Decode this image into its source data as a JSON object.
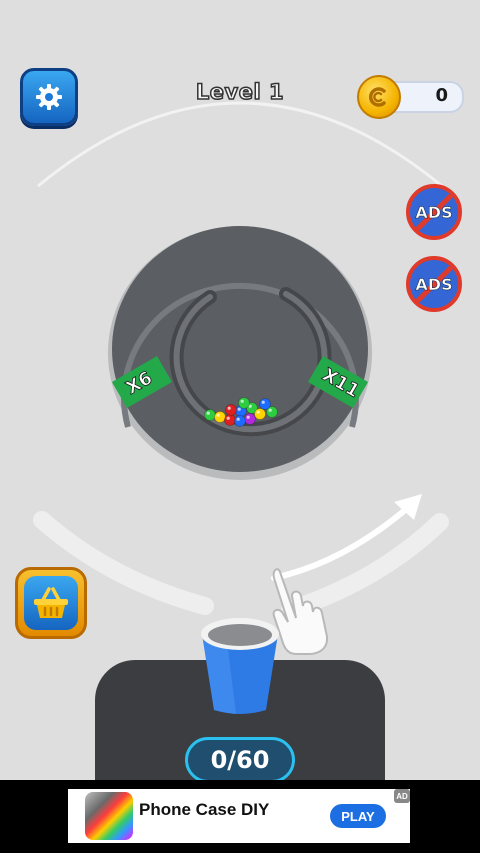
{
  "header": {
    "level_title": "Level 1",
    "coins": "0"
  },
  "icons": {
    "settings": "gear-icon",
    "coin": "coin-icon",
    "shop": "basket-icon",
    "hand": "pointer-hand-icon"
  },
  "side_buttons": {
    "no_ads_1": "ADS",
    "no_ads_2": "ADS"
  },
  "maze": {
    "multiplier_left": "X6",
    "multiplier_right": "X11",
    "balls": [
      {
        "color": "#2ecc40"
      },
      {
        "color": "#ffd400"
      },
      {
        "color": "#e02020"
      },
      {
        "color": "#1e6bff"
      },
      {
        "color": "#b02adf"
      },
      {
        "color": "#2ecc40"
      },
      {
        "color": "#1e6bff"
      },
      {
        "color": "#ffd400"
      },
      {
        "color": "#2ecc40"
      },
      {
        "color": "#1e6bff"
      },
      {
        "color": "#e02020"
      },
      {
        "color": "#2ecc40"
      }
    ]
  },
  "cup": {
    "progress_text": "0/60",
    "filled": 0,
    "capacity": 60
  },
  "ad": {
    "title": "Phone Case DIY",
    "cta": "PLAY",
    "badge": "AD"
  },
  "colors": {
    "background": "#dedede",
    "accent_blue": "#1565c0",
    "multiplier_green": "#23a84a",
    "maze_gray": "#5a5d61"
  }
}
